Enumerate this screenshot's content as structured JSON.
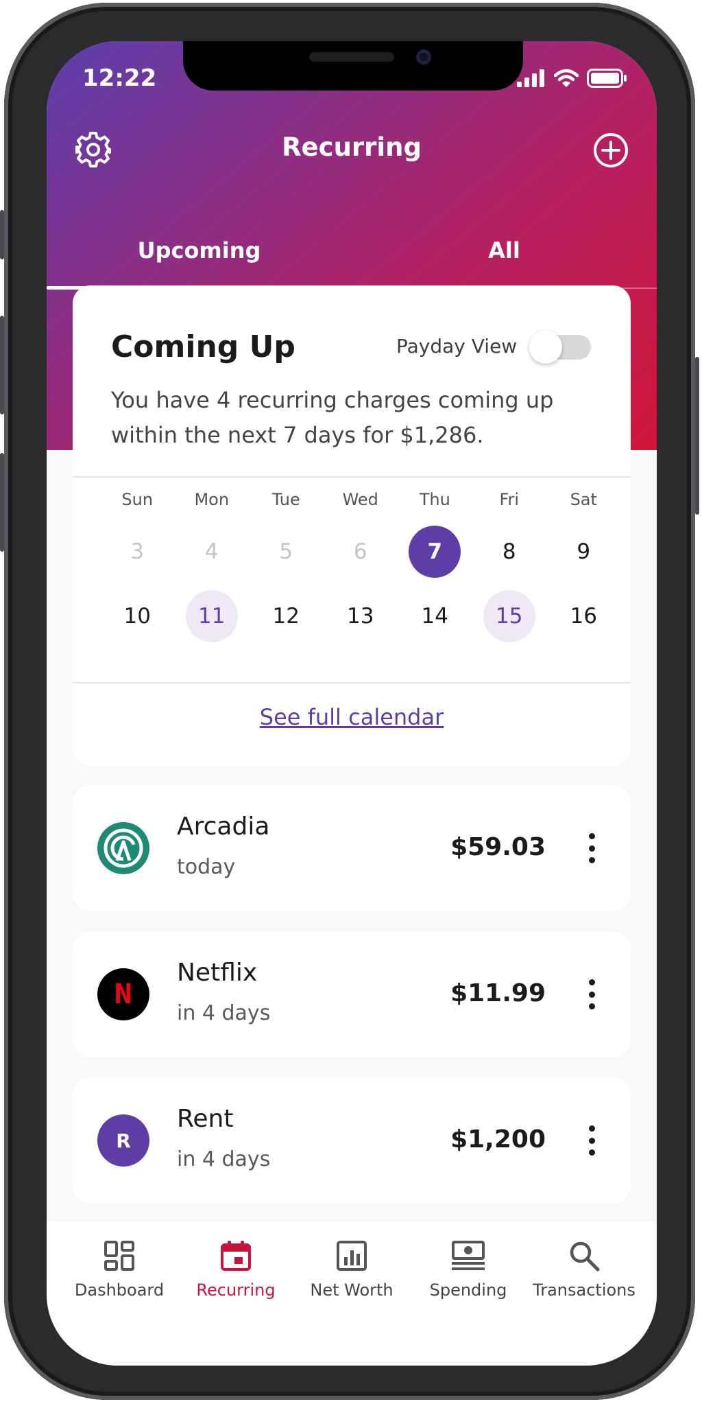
{
  "status_bar": {
    "time": "12:22"
  },
  "header": {
    "title": "Recurring"
  },
  "tabs": [
    {
      "label": "Upcoming",
      "active": true
    },
    {
      "label": "All",
      "active": false
    }
  ],
  "summary": {
    "title": "Coming Up",
    "payday_label": "Payday View",
    "payday_enabled": false,
    "description": "You have 4 recurring charges coming up within the next 7 days for $1,286.",
    "weekdays": [
      "Sun",
      "Mon",
      "Tue",
      "Wed",
      "Thu",
      "Fri",
      "Sat"
    ],
    "week1": [
      "3",
      "4",
      "5",
      "6",
      "7",
      "8",
      "9"
    ],
    "week2": [
      "10",
      "11",
      "12",
      "13",
      "14",
      "15",
      "16"
    ],
    "today": "7",
    "charge_days": [
      "11",
      "15"
    ],
    "see_calendar": "See full calendar"
  },
  "charges": [
    {
      "name": "Arcadia",
      "when": "today",
      "amount": "$59.03",
      "icon": "arcadia-logo-icon"
    },
    {
      "name": "Netflix",
      "when": "in 4 days",
      "amount": "$11.99",
      "icon": "netflix-logo-icon",
      "letter": "N"
    },
    {
      "name": "Rent",
      "when": "in 4 days",
      "amount": "$1,200",
      "icon": "initial-avatar-icon",
      "letter": "R"
    }
  ],
  "nav": [
    {
      "label": "Dashboard",
      "icon": "dashboard-icon"
    },
    {
      "label": "Recurring",
      "icon": "calendar-icon",
      "active": true
    },
    {
      "label": "Net Worth",
      "icon": "bar-chart-icon"
    },
    {
      "label": "Spending",
      "icon": "banknote-icon"
    },
    {
      "label": "Transactions",
      "icon": "search-icon"
    }
  ],
  "colors": {
    "brand_purple": "#5e3ea6",
    "brand_red": "#c6163f",
    "charge_highlight": "#efe9f7",
    "arcadia_green": "#1f8a73",
    "netflix_red": "#e50914"
  }
}
